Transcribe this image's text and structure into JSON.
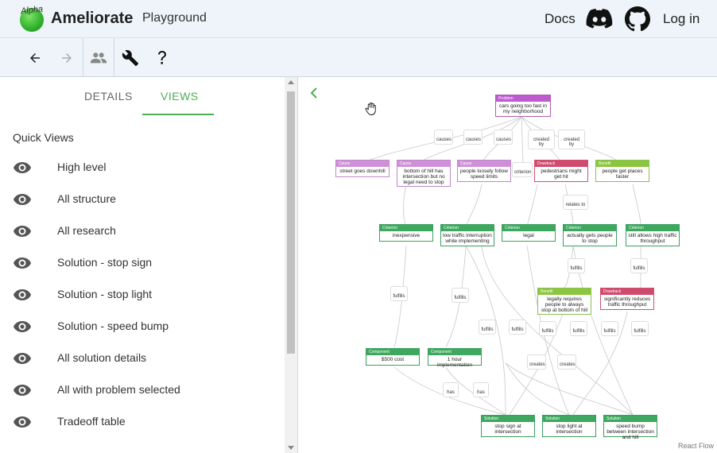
{
  "header": {
    "alpha": "Alpha",
    "brand": "Ameliorate",
    "playground": "Playground",
    "docs": "Docs",
    "login": "Log in"
  },
  "toolbar": {
    "icons": [
      "arrow-back-icon",
      "arrow-forward-icon",
      "people-icon",
      "wrench-icon",
      "help-icon"
    ]
  },
  "tabs": {
    "details": "DETAILS",
    "views": "VIEWS"
  },
  "quick_views": {
    "title": "Quick Views",
    "items": [
      "High level",
      "All structure",
      "All research",
      "Solution - stop sign",
      "Solution - stop light",
      "Solution - speed bump",
      "All solution details",
      "All with problem selected",
      "Tradeoff table"
    ]
  },
  "graph": {
    "react_flow": "React Flow",
    "nodes": {
      "problem": {
        "type": "Problem",
        "text": "cars going too fast in my neighborhood"
      },
      "cause1": {
        "type": "Cause",
        "text": "street goes downhill"
      },
      "cause2": {
        "type": "Cause",
        "text": "bottom of hill has intersection but no legal need to stop"
      },
      "cause3": {
        "type": "Cause",
        "text": "people loosely follow speed limits"
      },
      "drawback1": {
        "type": "Drawback",
        "text": "pedestrians might get hit"
      },
      "benefit1": {
        "type": "Benefit",
        "text": "people get places faster"
      },
      "crit1": {
        "type": "Criterion",
        "text": "inexpensive"
      },
      "crit2": {
        "type": "Criterion",
        "text": "low traffic interruption while implementing"
      },
      "crit3": {
        "type": "Criterion",
        "text": "legal"
      },
      "crit4": {
        "type": "Criterion",
        "text": "actually gets people to stop"
      },
      "crit5": {
        "type": "Criterion",
        "text": "still allows high traffic throughput"
      },
      "benefit2": {
        "type": "Benefit",
        "text": "legally requires people to always stop at bottom of hill"
      },
      "drawback2": {
        "type": "Drawback",
        "text": "significantly reduces traffic throughput"
      },
      "comp1": {
        "type": "Component",
        "text": "$500 cost"
      },
      "comp2": {
        "type": "Component",
        "text": "1 hour implementation"
      },
      "sol1": {
        "type": "Solution",
        "text": "stop sign at intersection"
      },
      "sol2": {
        "type": "Solution",
        "text": "stop light at intersection"
      },
      "sol3": {
        "type": "Solution",
        "text": "speed bump between intersection and hill"
      }
    },
    "edge_labels": {
      "causes": "causes",
      "created_by": "created by",
      "criterion_for": "criterion",
      "relates_to": "relates to",
      "fulfills": "fulfills",
      "creates": "creates",
      "has": "has"
    }
  }
}
